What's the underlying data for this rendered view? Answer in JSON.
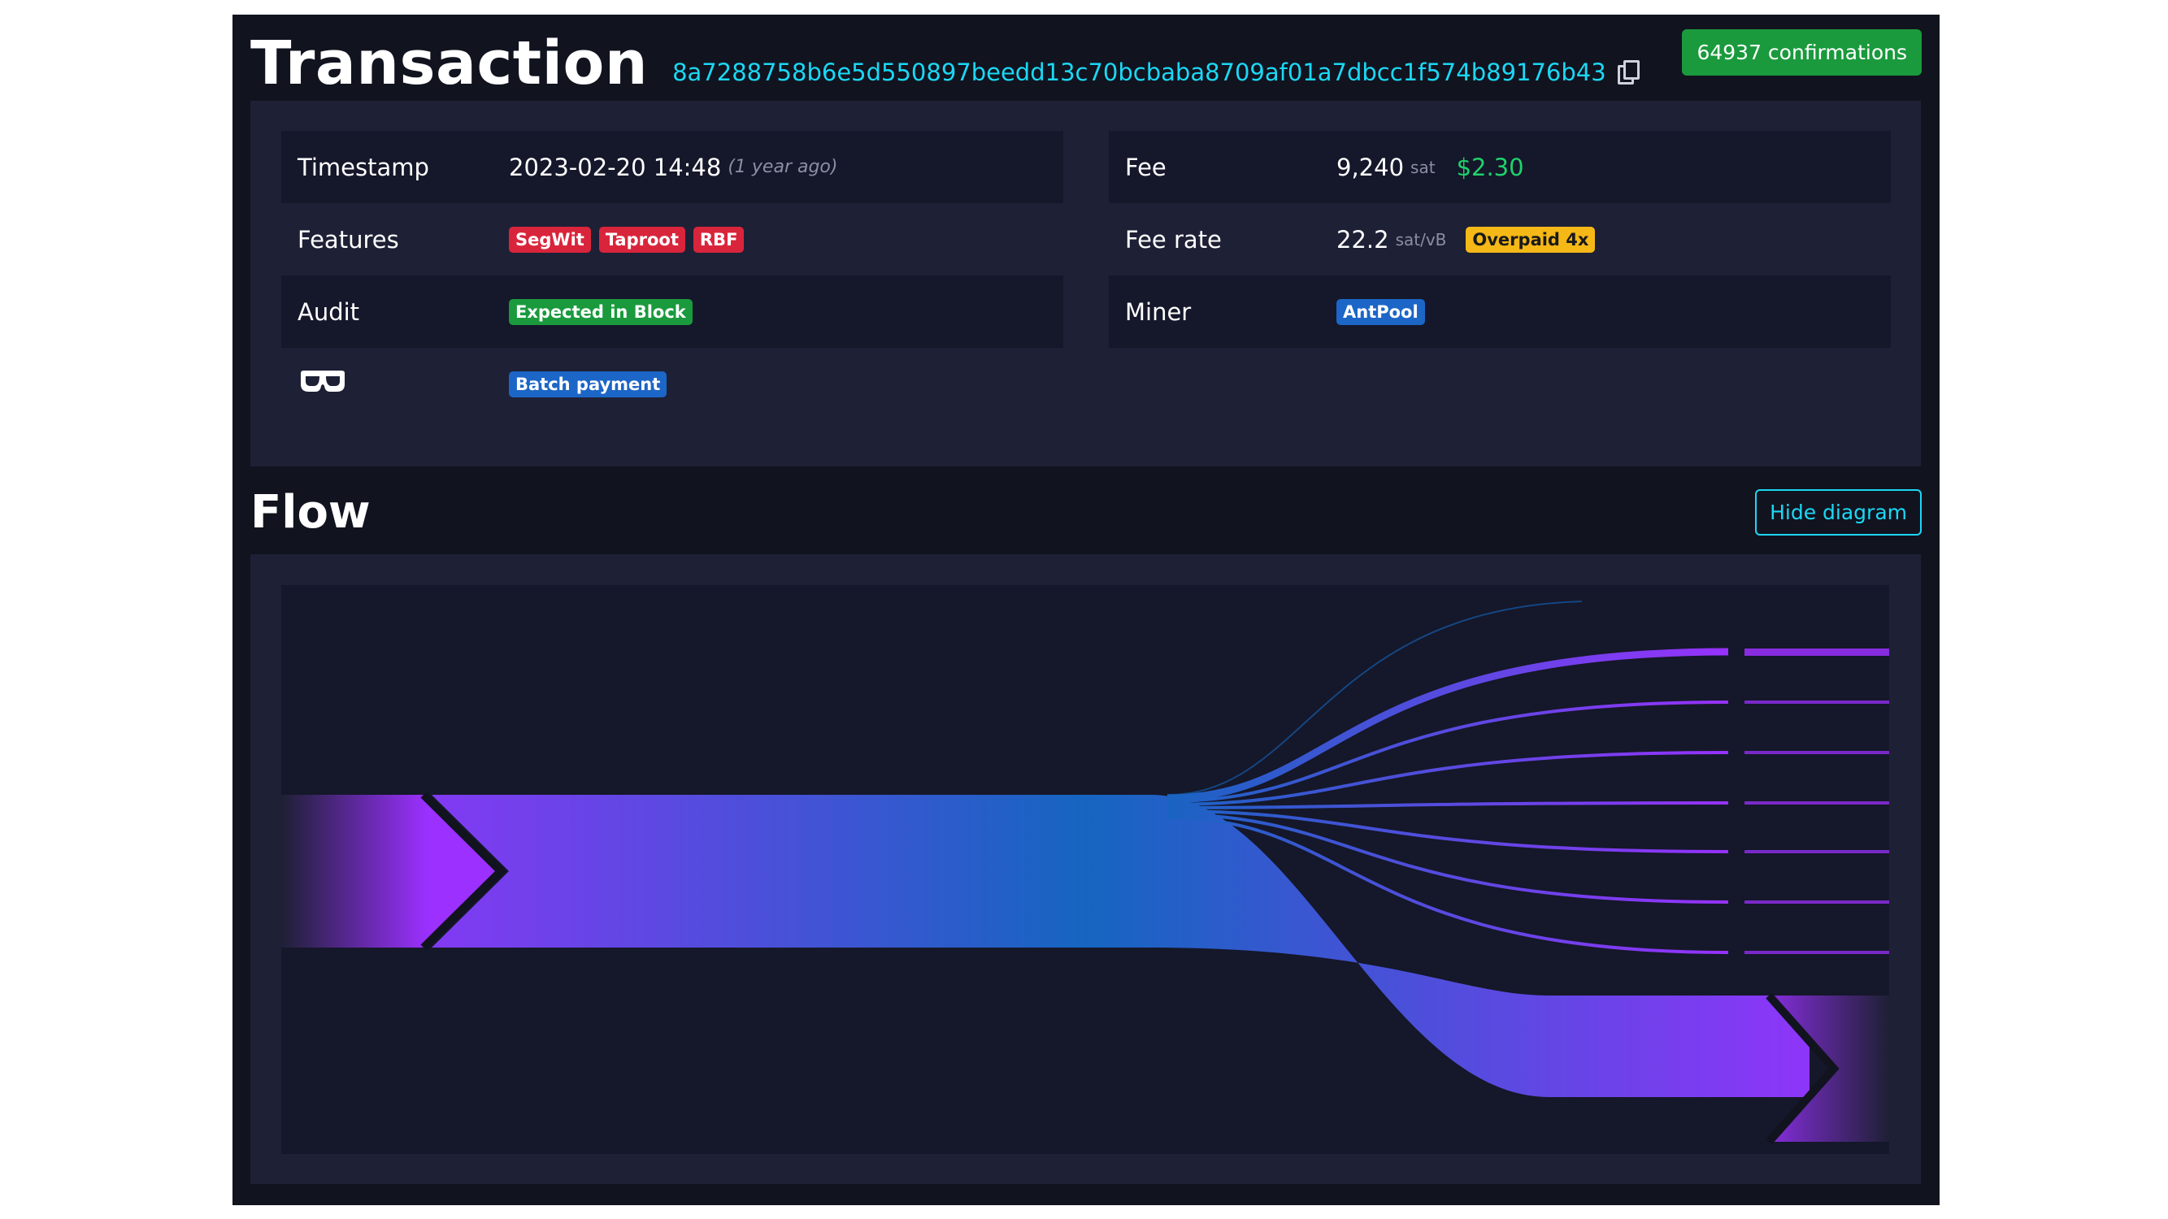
{
  "header": {
    "title": "Transaction",
    "txid": "8a7288758b6e5d550897beedd13c70bcbaba8709af01a7dbcc1f574b89176b43",
    "confirmations": "64937 confirmations"
  },
  "details": {
    "left": {
      "timestamp": {
        "label": "Timestamp",
        "value": "2023-02-20 14:48",
        "relative": "(1 year ago)"
      },
      "features": {
        "label": "Features",
        "badges": [
          "SegWit",
          "Taproot",
          "RBF"
        ]
      },
      "audit": {
        "label": "Audit",
        "badge": "Expected in Block"
      },
      "goggles": {
        "badge": "Batch payment"
      }
    },
    "right": {
      "fee": {
        "label": "Fee",
        "value": "9,240",
        "unit": "sat",
        "usd": "$2.30"
      },
      "fee_rate": {
        "label": "Fee rate",
        "value": "22.2",
        "unit": "sat/vB",
        "badge": "Overpaid 4x"
      },
      "miner": {
        "label": "Miner",
        "badge": "AntPool"
      }
    }
  },
  "flow": {
    "title": "Flow",
    "hide_button": "Hide diagram"
  },
  "colors": {
    "accent": "#1bd8f4",
    "positive": "#1fd16b",
    "badge_red": "#d9253c",
    "badge_green": "#1a9a3d",
    "badge_blue": "#1c66c7",
    "badge_yellow": "#f5b817",
    "flow_purple": "#9b30ff",
    "flow_blue": "#1565c0"
  }
}
